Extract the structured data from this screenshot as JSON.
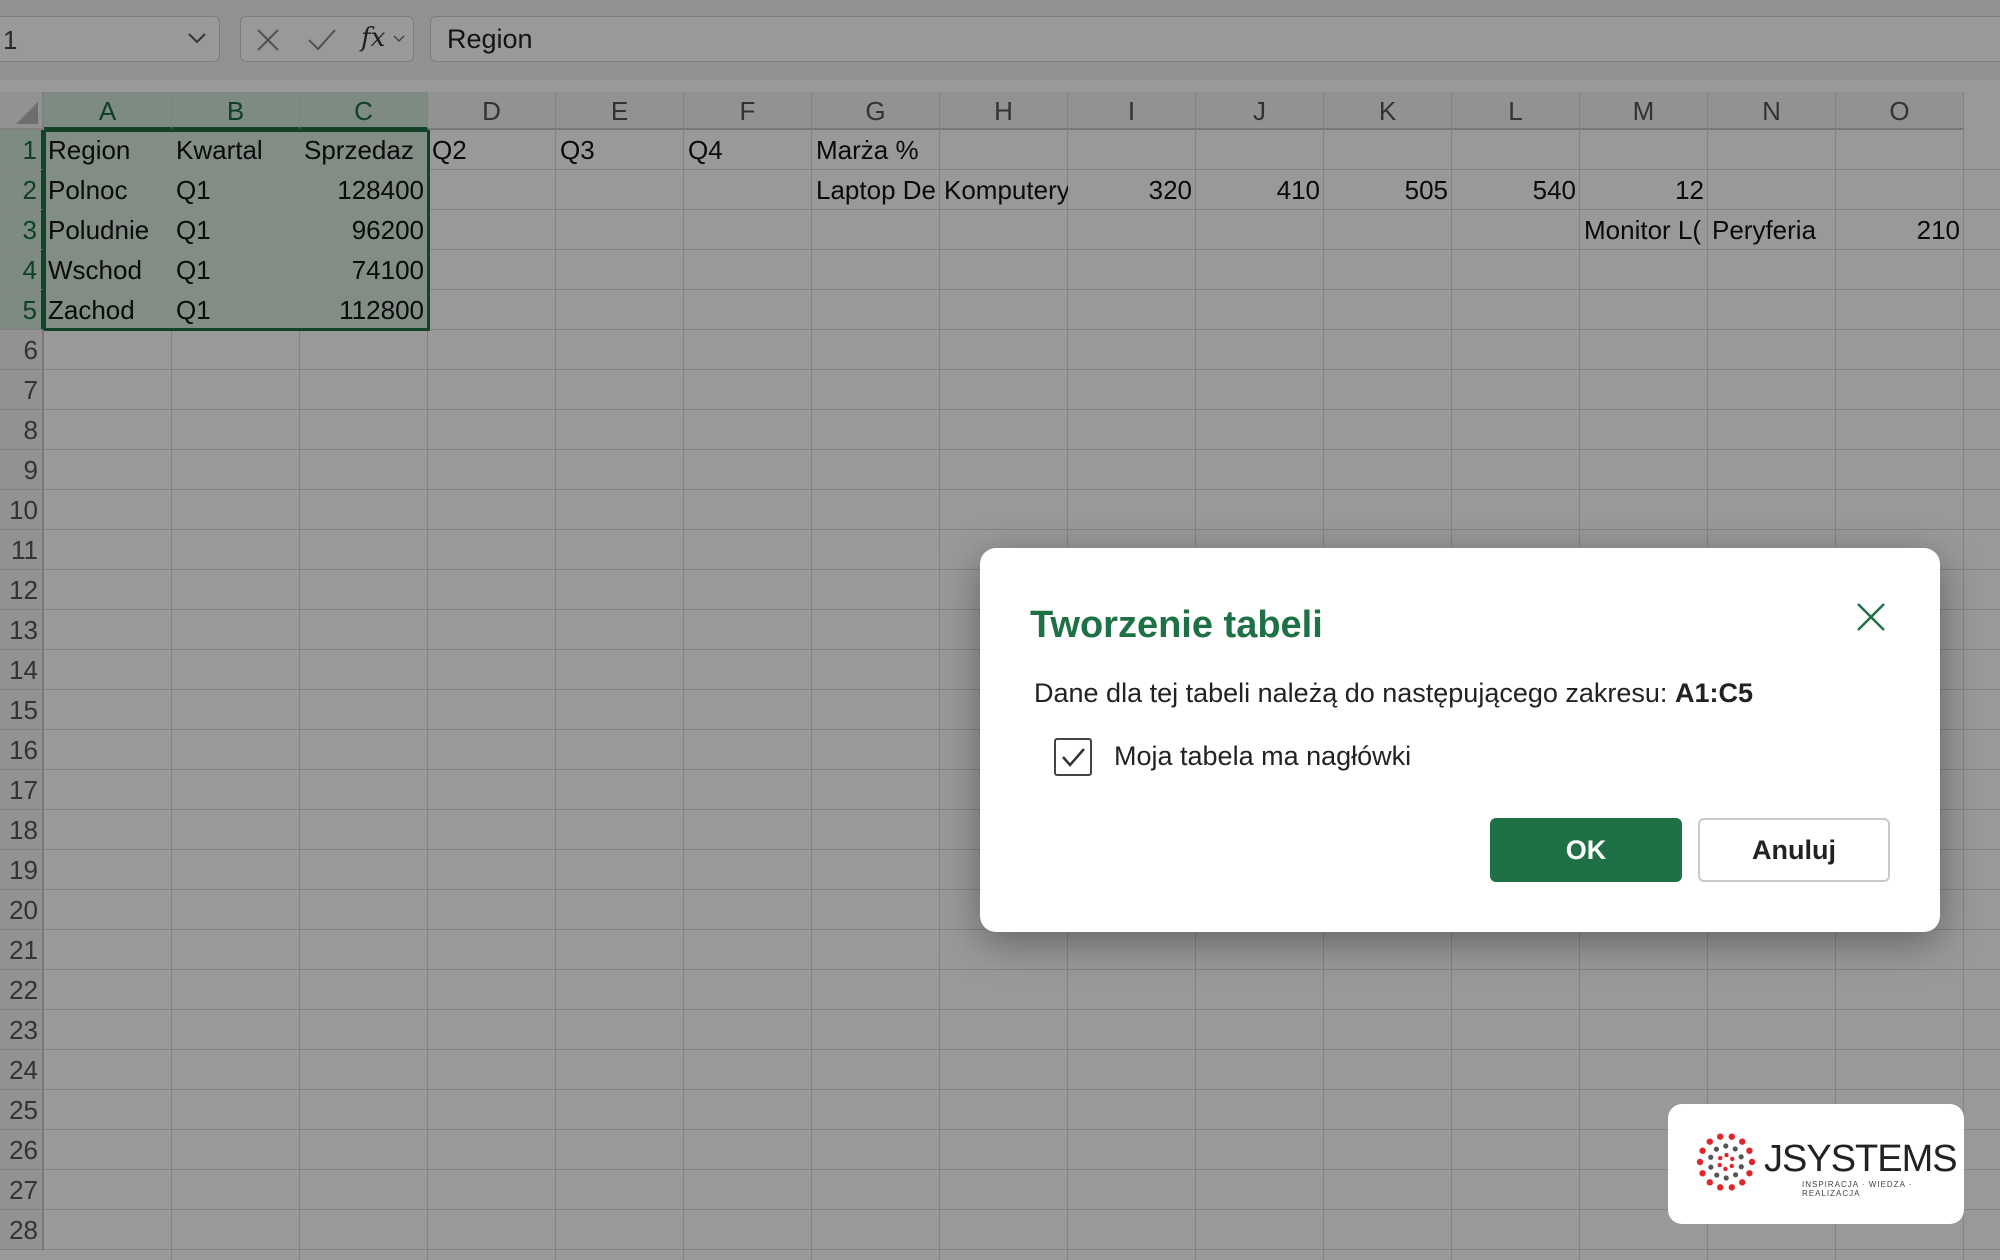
{
  "formula_bar": {
    "name_box": "1",
    "formula": "Region"
  },
  "sheet": {
    "columns": [
      "A",
      "B",
      "C",
      "D",
      "E",
      "F",
      "G",
      "H",
      "I",
      "J",
      "K",
      "L",
      "M",
      "N",
      "O"
    ],
    "selected_columns": [
      "A",
      "B",
      "C"
    ],
    "rows": [
      "1",
      "2",
      "3",
      "4",
      "5",
      "6",
      "7",
      "8",
      "9",
      "10",
      "11",
      "12",
      "13",
      "14",
      "15",
      "16",
      "17",
      "18",
      "19",
      "20",
      "21",
      "22",
      "23",
      "24",
      "25",
      "26",
      "27",
      "28"
    ],
    "selected_rows": [
      "1",
      "2",
      "3",
      "4",
      "5"
    ],
    "cells": [
      {
        "ref": "A1",
        "value": "Region",
        "align": "left"
      },
      {
        "ref": "B1",
        "value": "Kwartal",
        "align": "left"
      },
      {
        "ref": "C1",
        "value": "Sprzedaz",
        "align": "left"
      },
      {
        "ref": "D1",
        "value": "Q2",
        "align": "left"
      },
      {
        "ref": "E1",
        "value": "Q3",
        "align": "left"
      },
      {
        "ref": "F1",
        "value": "Q4",
        "align": "left"
      },
      {
        "ref": "G1",
        "value": "Marża %",
        "align": "left"
      },
      {
        "ref": "A2",
        "value": "Polnoc",
        "align": "left"
      },
      {
        "ref": "B2",
        "value": "Q1",
        "align": "left"
      },
      {
        "ref": "C2",
        "value": "128400",
        "align": "right"
      },
      {
        "ref": "G2",
        "value": "Laptop De",
        "align": "left"
      },
      {
        "ref": "H2",
        "value": "Komputery",
        "align": "left"
      },
      {
        "ref": "I2",
        "value": "320",
        "align": "right"
      },
      {
        "ref": "J2",
        "value": "410",
        "align": "right"
      },
      {
        "ref": "K2",
        "value": "505",
        "align": "right"
      },
      {
        "ref": "L2",
        "value": "540",
        "align": "right"
      },
      {
        "ref": "M2",
        "value": "12",
        "align": "right"
      },
      {
        "ref": "A3",
        "value": "Poludnie",
        "align": "left"
      },
      {
        "ref": "B3",
        "value": "Q1",
        "align": "left"
      },
      {
        "ref": "C3",
        "value": "96200",
        "align": "right"
      },
      {
        "ref": "M3",
        "value": "Monitor L(",
        "align": "left"
      },
      {
        "ref": "N3",
        "value": "Peryferia",
        "align": "left"
      },
      {
        "ref": "O3",
        "value": "210",
        "align": "right"
      },
      {
        "ref": "A4",
        "value": "Wschod",
        "align": "left"
      },
      {
        "ref": "B4",
        "value": "Q1",
        "align": "left"
      },
      {
        "ref": "C4",
        "value": "74100",
        "align": "right"
      },
      {
        "ref": "A5",
        "value": "Zachod",
        "align": "left"
      },
      {
        "ref": "B5",
        "value": "Q1",
        "align": "left"
      },
      {
        "ref": "C5",
        "value": "112800",
        "align": "right"
      }
    ]
  },
  "dialog": {
    "title": "Tworzenie tabeli",
    "range_prompt": "Dane dla tej tabeli należą do następującego zakresu:",
    "range_value": "A1:C5",
    "headers_checkbox_label": "Moja tabela ma nagłówki",
    "headers_checked": true,
    "ok_label": "OK",
    "cancel_label": "Anuluj"
  },
  "logo": {
    "wordmark": "JSYSTEMS",
    "tagline": "INSPIRACJA · WIEDZA · REALIZACJA"
  },
  "colors": {
    "accent": "#1e7145",
    "selection_fill": "#d9ece0",
    "logo_red": "#e0262b"
  }
}
